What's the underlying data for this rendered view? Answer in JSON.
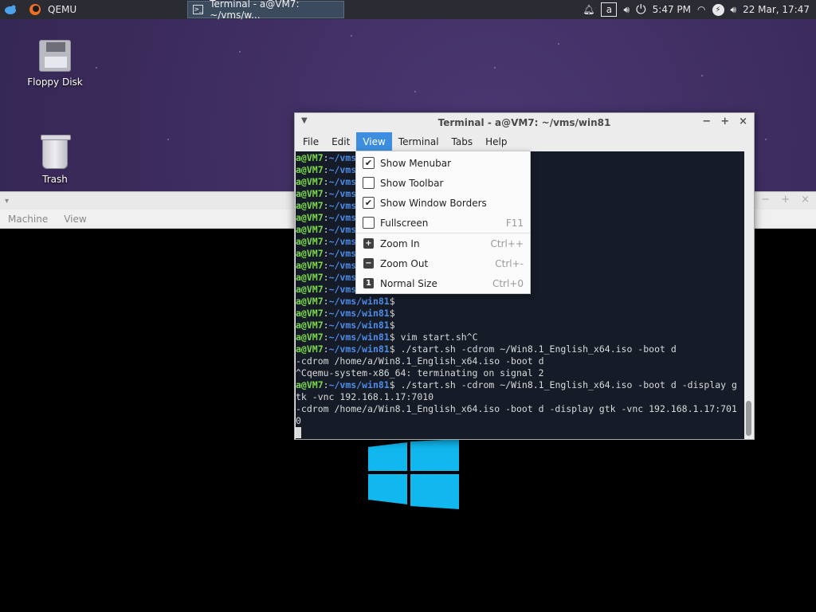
{
  "panel": {
    "launcher_label": "QEMU",
    "task_title": "Terminal - a@VM7: ~/vms/w...",
    "keyboard_layout": "a",
    "time": "5:47 PM",
    "date": "22 Mar, 17:47"
  },
  "desktop": {
    "icons": [
      {
        "label": "Floppy Disk"
      },
      {
        "label": "Trash"
      }
    ]
  },
  "qemu": {
    "menu": [
      "Machine",
      "View"
    ]
  },
  "terminal": {
    "title": "Terminal - a@VM7: ~/vms/win81",
    "menu": [
      "File",
      "Edit",
      "View",
      "Terminal",
      "Tabs",
      "Help"
    ],
    "active_menu": "View",
    "prompt_user": "a@VM7",
    "prompt_path": "~/vms/win81",
    "lines": [
      {
        "prompt": true,
        "partial": true,
        "text": ""
      },
      {
        "prompt": true,
        "partial": true,
        "text": ""
      },
      {
        "prompt": true,
        "partial": true,
        "text": ""
      },
      {
        "prompt": true,
        "partial": true,
        "text": ""
      },
      {
        "prompt": true,
        "partial": true,
        "text": ""
      },
      {
        "prompt": true,
        "partial": true,
        "text": ""
      },
      {
        "prompt": true,
        "partial": true,
        "text": ""
      },
      {
        "prompt": true,
        "partial": true,
        "text": ""
      },
      {
        "prompt": true,
        "partial": true,
        "text": ""
      },
      {
        "prompt": true,
        "partial": true,
        "text": ""
      },
      {
        "prompt": true,
        "partial": true,
        "text": ""
      },
      {
        "prompt": true,
        "partial": true,
        "text": ""
      },
      {
        "prompt": true,
        "partial": false,
        "text": ""
      },
      {
        "prompt": true,
        "partial": false,
        "text": ""
      },
      {
        "prompt": true,
        "partial": false,
        "text": ""
      },
      {
        "prompt": true,
        "partial": false,
        "text": " vim start.sh^C"
      },
      {
        "prompt": true,
        "partial": false,
        "text": " ./start.sh -cdrom ~/Win8.1_English_x64.iso -boot d"
      },
      {
        "prompt": false,
        "text": "-cdrom /home/a/Win8.1_English_x64.iso -boot d"
      },
      {
        "prompt": false,
        "text": "^Cqemu-system-x86_64: terminating on signal 2"
      },
      {
        "prompt": true,
        "partial": false,
        "text": " ./start.sh -cdrom ~/Win8.1_English_x64.iso -boot d -display g"
      },
      {
        "prompt": false,
        "text": "tk -vnc 192.168.1.17:7010"
      },
      {
        "prompt": false,
        "text": "-cdrom /home/a/Win8.1_English_x64.iso -boot d -display gtk -vnc 192.168.1.17:701"
      },
      {
        "prompt": false,
        "text": "0"
      }
    ]
  },
  "view_menu": {
    "items": [
      {
        "type": "check",
        "label": "Show Menubar",
        "checked": true,
        "accel": ""
      },
      {
        "type": "check",
        "label": "Show Toolbar",
        "checked": false,
        "accel": ""
      },
      {
        "type": "check",
        "label": "Show Window Borders",
        "checked": true,
        "accel": ""
      },
      {
        "type": "check",
        "label": "Fullscreen",
        "checked": false,
        "accel": "F11"
      },
      {
        "type": "action",
        "icon": "+",
        "label": "Zoom In",
        "accel": "Ctrl++"
      },
      {
        "type": "action",
        "icon": "−",
        "label": "Zoom Out",
        "accel": "Ctrl+-"
      },
      {
        "type": "action",
        "icon": "1",
        "label": "Normal Size",
        "accel": "Ctrl+0"
      }
    ]
  },
  "colors": {
    "prompt_user": "#7cd74c",
    "prompt_path": "#4f8ce9",
    "menu_highlight": "#3d8ee0",
    "terminal_bg": "#151c28"
  }
}
